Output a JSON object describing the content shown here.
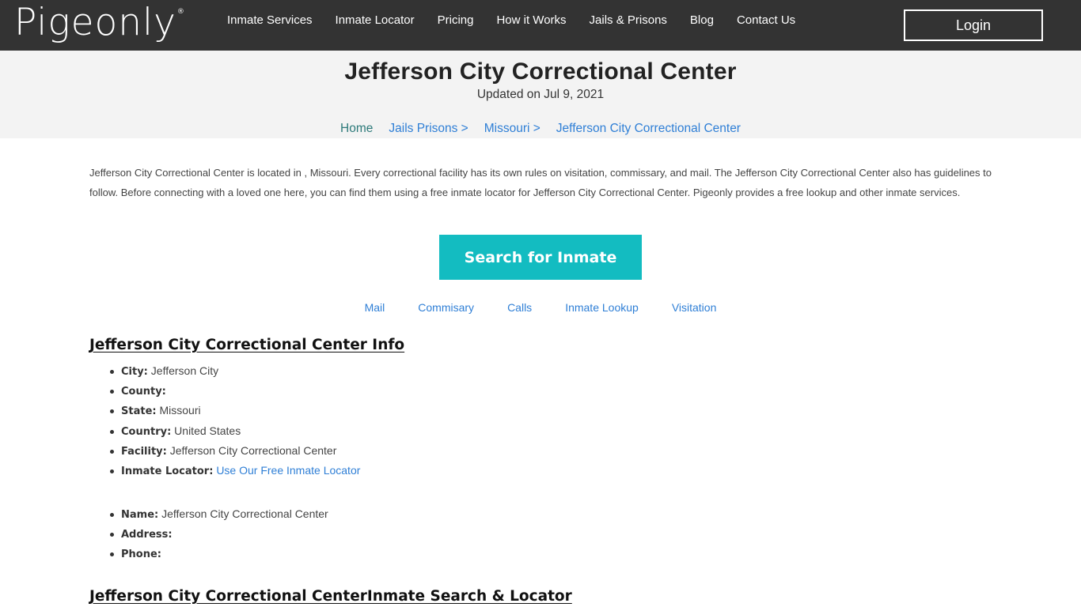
{
  "nav": {
    "logo": "Pigeonly",
    "logo_mark": "®",
    "items": [
      {
        "label": "Inmate Services"
      },
      {
        "label": "Inmate Locator"
      },
      {
        "label": "Pricing"
      },
      {
        "label": "How it Works"
      },
      {
        "label": "Jails & Prisons"
      },
      {
        "label": "Blog"
      },
      {
        "label": "Contact Us"
      }
    ],
    "login_label": "Login"
  },
  "header": {
    "title": "Jefferson City Correctional Center",
    "updated": "Updated on Jul 9, 2021",
    "breadcrumb": [
      {
        "label": "Home"
      },
      {
        "label": "Jails Prisons >"
      },
      {
        "label": "Missouri >"
      },
      {
        "label": "Jefferson City Correctional Center"
      }
    ]
  },
  "intro": "Jefferson City Correctional Center is located in , Missouri. Every correctional facility has its own rules on visitation, commissary, and mail. The Jefferson City Correctional Center also has guidelines to follow. Before connecting with a loved one here, you can find them using a free inmate locator for Jefferson City Correctional Center. Pigeonly provides a free lookup and other inmate services.",
  "search_button": "Search for Inmate",
  "quicklinks": [
    {
      "label": "Mail"
    },
    {
      "label": "Commisary"
    },
    {
      "label": "Calls"
    },
    {
      "label": "Inmate Lookup"
    },
    {
      "label": "Visitation"
    }
  ],
  "info_section": {
    "heading": "Jefferson City Correctional Center Info",
    "facts": [
      {
        "key": "City:",
        "value": "Jefferson City"
      },
      {
        "key": "County:",
        "value": ""
      },
      {
        "key": "State:",
        "value": "Missouri"
      },
      {
        "key": "Country:",
        "value": "United States"
      },
      {
        "key": "Facility:",
        "value": "Jefferson City Correctional Center"
      },
      {
        "key": "Inmate Locator:",
        "link": "Use Our Free Inmate Locator"
      }
    ],
    "contact": [
      {
        "key": "Name:",
        "value": "Jefferson City Correctional Center"
      },
      {
        "key": "Address:",
        "value": ""
      },
      {
        "key": "Phone:",
        "value": ""
      }
    ]
  },
  "search_section": {
    "heading": "Jefferson City Correctional CenterInmate Search & Locator"
  },
  "colors": {
    "topbar": "#333333",
    "hero_bg": "#f3f3f3",
    "accent": "#13bcc1",
    "link": "#2f7fd6"
  }
}
